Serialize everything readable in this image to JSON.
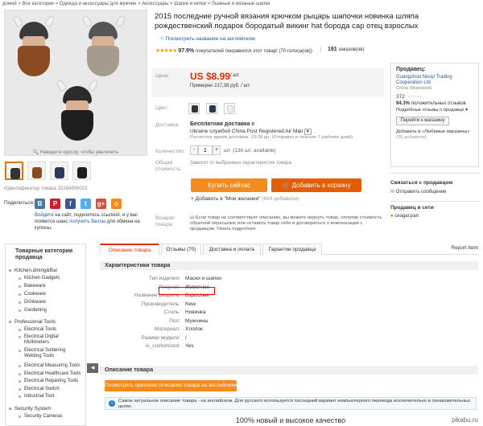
{
  "breadcrumb": "домой > Все категории > Одежда и аксессуары для мужчин > Аксессуары > Шапки и кепки > Лыжные и вязаные шапки",
  "product": {
    "title": "2015 последние ручной вязания крючком рыцарь шапочки новинка шляпа рождественский подарок бородатый викинг hat борода сар отец взрослых",
    "view_english": "Посмотреть название на английском",
    "rating": "97.9%",
    "rating_text": "покупателей понравился этот товар! (70 голоса(ов))",
    "orders_count": "191",
    "orders_label": "заказов(ов)",
    "price_label": "Цена:",
    "price": "US $8.99",
    "price_unit": "/ шт.",
    "price_rub": "Примерно 217,38 руб. / шт.",
    "color_label": "Цвет:",
    "delivery_label": "Доставка:",
    "free_shipping": "Бесплатная доставка",
    "shipping_to": "в",
    "shipping_country": "Ukraine",
    "shipping_method": "службой China Post Registered Air Mail",
    "delivery_time": "Расчетное время доставки: 15-39 дн. (Отправка в течение 7 рабочих дней)",
    "qty_label": "Количество:",
    "qty": "1",
    "qty_avail": "шт. (136 шт. available)",
    "total_label": "Общая стоимость:",
    "total_text": "Зависит от выбранных характеристик товара",
    "buy_now": "Купить сейчас",
    "add_cart": "Добавить в корзину",
    "wishlist": "Добавить в \"Мои желания\"",
    "wishlist_count": "(654 добавили)",
    "return_label": "Возврат товара:",
    "return_text": "Если товар не соответствует описанию, вы можете вернуть товар, оплатив стоимость обратной пересылки, или оставить товар себе и договориться о компенсации с продавцом. Узнать подробнее",
    "zoom_hint": "Наведите курсор, чтобы увеличить",
    "item_id": "Идентификатор товара 32284956023"
  },
  "share": {
    "label": "Поделиться:",
    "text_prefix": "Войдите",
    "text_mid": "на сайт, поделитесь ссылкой, и у вас появится шанс",
    "text_link": "получить баллы",
    "text_end": "для обмена на купоны."
  },
  "seller": {
    "label": "Продавец:",
    "name": "Guangzhou Nooyi Trading Cooperation Ltd",
    "country": "China (Mainland)",
    "score": "372",
    "positive": "94.3%",
    "positive_text": "положительных отзывов",
    "details": "Подробные отзывы о продавце",
    "store_button": "Перейти к магазину",
    "fav_text": "Добавить в «Любимые магазины»",
    "fav_count": "(35 добавили)"
  },
  "contact": {
    "title": "Связаться с продавцом",
    "send": "Отправить сообщение",
    "online_title": "Продавец в сети",
    "online_name": "ceagar.pan"
  },
  "categories": {
    "title": "Товарные категории продавца",
    "items": [
      "Kitchen,dining&Bar",
      "Kitchen Gadgets",
      "Bakeware",
      "Cookware",
      "Drinkware",
      "Gardening",
      "Professional Tools",
      "Electrical Tools",
      "Electrical Digital Multimeters",
      "Electrical Soldering Welding Tools",
      "Electrical Measuring Tools",
      "Electrical Healthcare Tools",
      "Electrical Repairing Tools",
      "Electrical Switch",
      "Industrial Tool",
      "Security System",
      "Security Cameras"
    ]
  },
  "tabs": [
    "Описание товара",
    "Отзывы (70)",
    "Доставка и оплата",
    "Гарантии продавца"
  ],
  "report": "Report item",
  "specs": {
    "title": "Характеристики товара",
    "rows": [
      {
        "k": "Тип изделия:",
        "v": "Маски и шапки"
      },
      {
        "k": "Рисунок:",
        "v": "Животное"
      },
      {
        "k": "Название раздела:",
        "v": "Взрослые"
      },
      {
        "k": "Производитель:",
        "v": "New"
      },
      {
        "k": "Стиль:",
        "v": "Новинка"
      },
      {
        "k": "Пол:",
        "v": "Мужчины"
      },
      {
        "k": "Материал:",
        "v": "Хлопок"
      },
      {
        "k": "Размер модели:",
        "v": "/"
      },
      {
        "k": "is_customized:",
        "v": "Yes"
      }
    ]
  },
  "description": {
    "title": "Описание товара",
    "eng_button": "Посмотреть оригинал описания товара на английском",
    "info": "Самое актуальное описание товара - на английском. Для русского используется последний вариант компьютерного перевода исключительно в ознакомительных целях.",
    "quality": "100% новый и высокое качество"
  },
  "watermark": "pikabu.ru",
  "colors": {
    "accent": "#e62e04",
    "orange": "#f58b1f",
    "link": "#2255aa"
  }
}
